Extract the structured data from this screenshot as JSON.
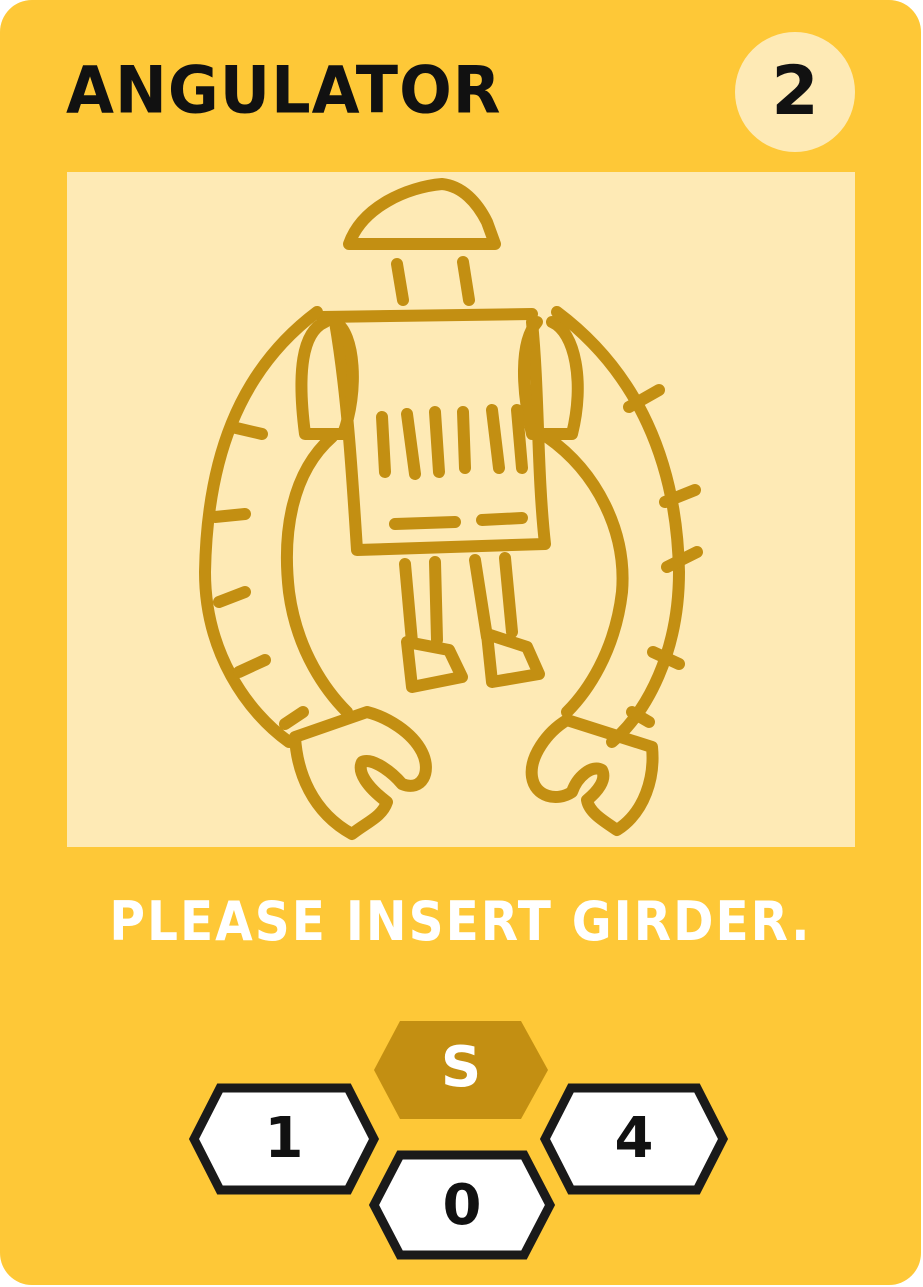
{
  "card": {
    "title": "ANGULATOR",
    "cost": "2",
    "flavor_text": "PLEASE INSERT GIRDER.",
    "art_icon": "robot-with-wrench-arms-icon",
    "colors": {
      "background": "#FEC837",
      "panel": "#FEEAB5",
      "art_stroke": "#C38F12",
      "text_dark": "#111111",
      "text_light": "#FFFFFF"
    },
    "stats": {
      "type_symbol": "S",
      "left": "1",
      "right": "4",
      "bottom": "0"
    }
  }
}
